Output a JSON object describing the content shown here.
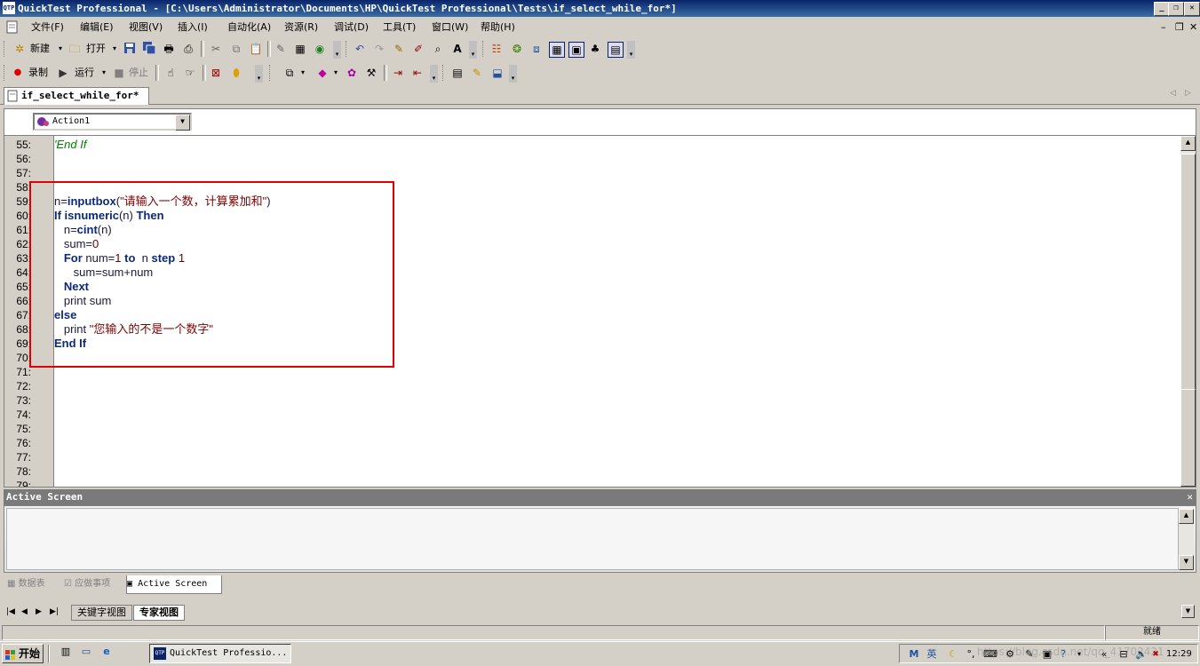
{
  "window": {
    "title": "QuickTest Professional - [C:\\Users\\Administrator\\Documents\\HP\\QuickTest Professional\\Tests\\if_select_while_for*]",
    "app_icon_text": "QTP"
  },
  "menu": [
    "文件(F)",
    "编辑(E)",
    "视图(V)",
    "插入(I)",
    "自动化(A)",
    "资源(R)",
    "调试(D)",
    "工具(T)",
    "窗口(W)",
    "帮助(H)"
  ],
  "toolbar1": {
    "new_label": "新建",
    "open_label": "打开"
  },
  "toolbar2": {
    "record_label": "录制",
    "run_label": "运行",
    "stop_label": "停止"
  },
  "document_tab": {
    "label": "if_select_while_for*"
  },
  "action_selector": {
    "value": "Action1"
  },
  "editor": {
    "line_numbers": [
      "55:",
      "56:",
      "57:",
      "58:",
      "59:",
      "60:",
      "61:",
      "62:",
      "63:",
      "64:",
      "65:",
      "66:",
      "67:",
      "68:",
      "69:",
      "70:",
      "71:",
      "72:",
      "73:",
      "74:",
      "75:",
      "76:",
      "77:",
      "78:",
      "79:"
    ],
    "l55": "'End If",
    "l59_a": "n=",
    "l59_b": "inputbox",
    "l59_c": "(",
    "l59_d": "\"请输入一个数，计算累加和\"",
    "l59_e": ")",
    "l60_a": "If isnumeric",
    "l60_b": "(n) ",
    "l60_c": "Then",
    "l61_a": "   n=",
    "l61_b": "cint",
    "l61_c": "(n)",
    "l62_a": "   sum=",
    "l62_b": "0",
    "l63_a": "   For",
    "l63_b": " num=",
    "l63_c": "1",
    "l63_d": " to",
    "l63_e": "  n ",
    "l63_f": "step",
    "l63_g": " 1",
    "l64": "      sum=sum+num",
    "l65": "   Next",
    "l66": "   print sum",
    "l67": "else",
    "l68_a": "   print ",
    "l68_b": "\"您输入的不是一个数字\"",
    "l69": "End If"
  },
  "active_screen": {
    "title": "Active Screen"
  },
  "bottom_tabs": [
    "数据表",
    "应做事项",
    "Active Screen"
  ],
  "sheet_tabs": [
    "关键字视图",
    "专家视图"
  ],
  "status": {
    "ready": "就绪"
  },
  "taskbar": {
    "start_label": "开始",
    "task_label": "QuickTest Professio...",
    "clock": "12:29",
    "watermark": "https://blog.csdn.net/qq_41702421"
  },
  "colors": {
    "title_bar": "#0a246a",
    "keyword": "#0b2a7a",
    "string": "#800000",
    "comment": "#008000",
    "highlight_box": "#e00000"
  }
}
